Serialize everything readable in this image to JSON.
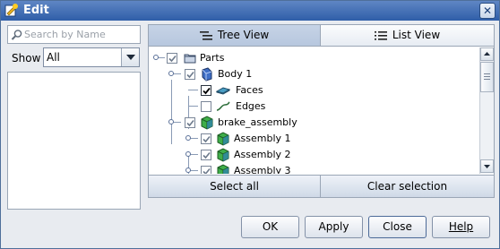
{
  "window": {
    "title": "Edit"
  },
  "search": {
    "placeholder": "Search by Name",
    "value": ""
  },
  "show": {
    "label": "Show",
    "selected": "All"
  },
  "tabs": {
    "tree_view": "Tree View",
    "list_view": "List View",
    "active": "Tree View"
  },
  "tree": {
    "nodes": [
      {
        "label": "Parts",
        "checked": true,
        "icon": "folder-icon"
      },
      {
        "label": "Body 1",
        "checked": true,
        "icon": "body-icon"
      },
      {
        "label": "Faces",
        "checked": true,
        "icon": "faces-icon"
      },
      {
        "label": "Edges",
        "checked": false,
        "icon": "edges-icon"
      },
      {
        "label": "brake_assembly",
        "checked": true,
        "icon": "assembly-icon"
      },
      {
        "label": "Assembly 1",
        "checked": true,
        "icon": "assembly-icon"
      },
      {
        "label": "Assembly 2",
        "checked": true,
        "icon": "assembly-icon"
      },
      {
        "label": "Assembly 3",
        "checked": true,
        "icon": "assembly-icon"
      }
    ]
  },
  "panel_buttons": {
    "select_all": "Select all",
    "clear_selection": "Clear selection"
  },
  "dialog_buttons": {
    "ok": "OK",
    "apply": "Apply",
    "close": "Close",
    "help": "Help"
  },
  "colors": {
    "titlebar": "#2f5ea8",
    "active_tab": "#b7c7de",
    "assembly_green": "#3fae49",
    "body_blue": "#3f6fc6"
  }
}
